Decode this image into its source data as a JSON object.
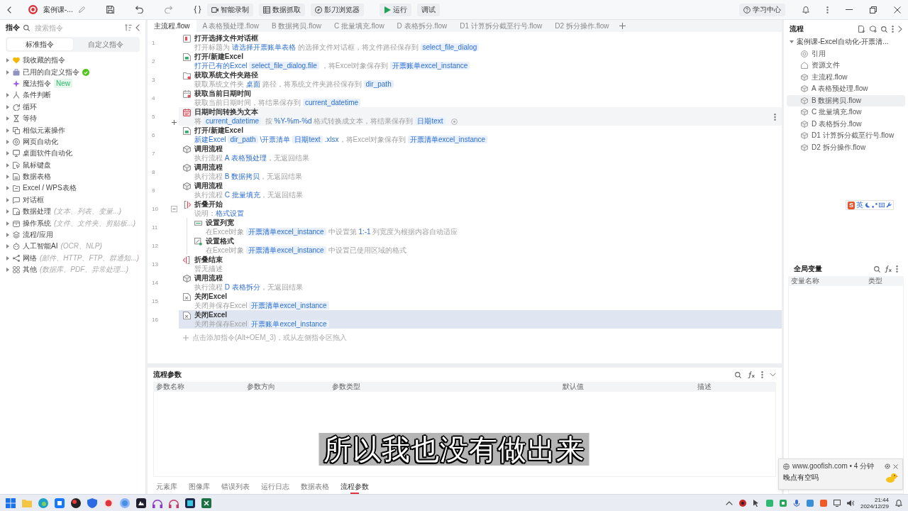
{
  "toolbar": {
    "title": "案例课-...",
    "actions": [
      {
        "kind": "record",
        "label": "智能录制"
      },
      {
        "kind": "capture",
        "label": "数据抓取"
      },
      {
        "kind": "browser",
        "label": "影刀浏览器"
      },
      {
        "kind": "run",
        "label": "运行"
      },
      {
        "kind": "debug",
        "label": "调试"
      }
    ],
    "help": "学习中心"
  },
  "commands": {
    "title": "指令",
    "search": {
      "placeholder": "搜索指令"
    },
    "tabs": [
      {
        "label": "标准指令",
        "selected": true
      },
      {
        "label": "自定义指令",
        "selected": false
      }
    ],
    "items": [
      {
        "kind": "favorites",
        "label": "我收藏的指令",
        "expanded": false
      },
      {
        "kind": "custom",
        "label": "已用的自定义指令",
        "expanded": false
      },
      {
        "kind": "magic",
        "label": "魔法指令",
        "tag": "New"
      },
      {
        "kind": "condition",
        "label": "条件判断",
        "expanded": false
      },
      {
        "kind": "loop",
        "label": "循环",
        "expanded": false
      },
      {
        "kind": "wait",
        "label": "等待",
        "expanded": false
      },
      {
        "kind": "similar",
        "label": "相似元素操作",
        "expanded": false
      },
      {
        "kind": "web",
        "label": "网页自动化",
        "expanded": false
      },
      {
        "kind": "desktop",
        "label": "桌面软件自动化",
        "expanded": false
      },
      {
        "kind": "mouse",
        "label": "鼠标键盘",
        "expanded": false
      },
      {
        "kind": "datatable",
        "label": "数据表格",
        "expanded": false
      },
      {
        "kind": "excel",
        "label": "Excel / WPS表格",
        "expanded": false
      },
      {
        "kind": "dialog",
        "label": "对话框",
        "expanded": false
      },
      {
        "kind": "data",
        "label": "数据处理",
        "hint": "(文本、列表、变量...)",
        "expanded": false
      },
      {
        "kind": "os",
        "label": "操作系统",
        "hint": "(文件、文件夹、剪贴板...)",
        "expanded": false
      },
      {
        "kind": "flow",
        "label": "流程/应用",
        "expanded": false
      },
      {
        "kind": "ai",
        "label": "人工智能AI",
        "hint": "(OCR、NLP)",
        "expanded": false
      },
      {
        "kind": "network",
        "label": "网络",
        "hint": "(邮件、HTTP、FTP、群通知...)",
        "expanded": false
      },
      {
        "kind": "other",
        "label": "其他",
        "hint": "(数据库、PDF、异常处理...)",
        "expanded": false
      }
    ]
  },
  "editor": {
    "tabs": [
      {
        "label": "主流程.flow",
        "selected": true
      },
      {
        "label": "A 表格预处理.flow",
        "selected": false
      },
      {
        "label": "B 数据拷贝.flow",
        "selected": false
      },
      {
        "label": "C 批量填充.flow",
        "selected": false
      },
      {
        "label": "D 表格拆分.flow",
        "selected": false
      },
      {
        "label": "D1 计算拆分截至行号.flow",
        "selected": false
      },
      {
        "label": "D2 拆分操作.flow",
        "selected": false
      }
    ],
    "steps": [
      {
        "number": "1",
        "kind": "file-dialog",
        "title": "打开选择文件对话框",
        "parts": [
          {
            "kind": "text",
            "text": "打开标题为 "
          },
          {
            "kind": "value",
            "text": "请选择开票账单表格"
          },
          {
            "kind": "text",
            "text": " 的选择文件对话框，将文件路径保存到"
          },
          {
            "kind": "var",
            "text": "select_file_dialog"
          }
        ],
        "selected": false,
        "hovered": false
      },
      {
        "number": "2",
        "kind": "open-excel",
        "title": "打开/新建Excel",
        "parts": [
          {
            "kind": "value",
            "text": "打开已有的Excel"
          },
          {
            "kind": "var",
            "text": "select_file_dialog.file"
          },
          {
            "kind": "text",
            "text": "，将Excel对象保存到"
          },
          {
            "kind": "var",
            "text": "开票账单excel_instance"
          }
        ],
        "selected": false,
        "hovered": false
      },
      {
        "number": "3",
        "kind": "folder-path",
        "title": "获取系统文件夹路径",
        "parts": [
          {
            "kind": "text",
            "text": "获取系统文件夹 "
          },
          {
            "kind": "value",
            "text": "桌面"
          },
          {
            "kind": "text",
            "text": " 路径，将系统文件夹路径保存到"
          },
          {
            "kind": "var",
            "text": "dir_path"
          }
        ],
        "selected": false,
        "hovered": false
      },
      {
        "number": "4",
        "kind": "datetime",
        "title": "获取当前日期时间",
        "parts": [
          {
            "kind": "text",
            "text": "获取当前日期时间，将结果保存到"
          },
          {
            "kind": "var",
            "text": "current_datetime"
          }
        ],
        "selected": false,
        "hovered": false
      },
      {
        "number": "5",
        "kind": "datetime-text",
        "title": "日期时间转换为文本",
        "parts": [
          {
            "kind": "text",
            "text": "将"
          },
          {
            "kind": "var",
            "text": "current_datetime"
          },
          {
            "kind": "text",
            "text": " 按 "
          },
          {
            "kind": "value",
            "text": "%Y-%m-%d"
          },
          {
            "kind": "text",
            "text": " 格式转换成文本，将结果保存到"
          },
          {
            "kind": "var",
            "text": "日期text"
          },
          {
            "kind": "icon"
          }
        ],
        "selected": false,
        "hovered": true
      },
      {
        "number": "6",
        "kind": "open-excel",
        "title": "打开/新建Excel",
        "parts": [
          {
            "kind": "value",
            "text": "新建Excel"
          },
          {
            "kind": "var",
            "text": "dir_path"
          },
          {
            "kind": "value",
            "text": "\\开票清单"
          },
          {
            "kind": "var",
            "text": "日期text"
          },
          {
            "kind": "value",
            "text": ".xlsx"
          },
          {
            "kind": "text",
            "text": "，将Excel对象保存到"
          },
          {
            "kind": "var",
            "text": "开票清单excel_instance"
          }
        ],
        "selected": false,
        "hovered": false
      },
      {
        "number": "7",
        "kind": "subflow",
        "title": "调用流程",
        "parts": [
          {
            "kind": "text",
            "text": "执行流程 "
          },
          {
            "kind": "value",
            "text": "A 表格预处理"
          },
          {
            "kind": "text",
            "text": "，无返回结果"
          }
        ],
        "selected": false,
        "hovered": false
      },
      {
        "number": "8",
        "kind": "subflow",
        "title": "调用流程",
        "parts": [
          {
            "kind": "text",
            "text": "执行流程 "
          },
          {
            "kind": "value",
            "text": "B 数据拷贝"
          },
          {
            "kind": "text",
            "text": "，无返回结果"
          }
        ],
        "selected": false,
        "hovered": false
      },
      {
        "number": "9",
        "kind": "subflow",
        "title": "调用流程",
        "parts": [
          {
            "kind": "text",
            "text": "执行流程 "
          },
          {
            "kind": "value",
            "text": "C 批量填充"
          },
          {
            "kind": "text",
            "text": "，无返回结果"
          }
        ],
        "selected": false,
        "hovered": false
      },
      {
        "number": "10",
        "kind": "fold-start",
        "title": "折叠开始",
        "parts": [
          {
            "kind": "text",
            "text": "说明："
          },
          {
            "kind": "value",
            "text": "格式设置"
          }
        ],
        "selected": false,
        "hovered": false,
        "expanded": true,
        "children": [
          {
            "number": "11",
            "kind": "column-width",
            "title": "设置列宽",
            "parts": [
              {
                "kind": "text",
                "text": "在Excel对象"
              },
              {
                "kind": "var",
                "text": "开票清单excel_instance"
              },
              {
                "kind": "text",
                "text": "中设置第 "
              },
              {
                "kind": "value",
                "text": "1:-1"
              },
              {
                "kind": "text",
                "text": " 列宽度为根据内容自动适应"
              }
            ],
            "selected": false,
            "hovered": false
          },
          {
            "number": "12",
            "kind": "cell-format",
            "title": "设置格式",
            "parts": [
              {
                "kind": "text",
                "text": "在Excel对象"
              },
              {
                "kind": "var",
                "text": "开票清单excel_instance"
              },
              {
                "kind": "text",
                "text": "中设置已使用区域的格式"
              }
            ],
            "selected": false,
            "hovered": false
          }
        ]
      },
      {
        "number": "13",
        "kind": "fold-end",
        "title": "折叠结束",
        "parts": [
          {
            "kind": "text",
            "text": "暂无描述"
          }
        ],
        "selected": false,
        "hovered": false
      },
      {
        "number": "14",
        "kind": "subflow",
        "title": "调用流程",
        "parts": [
          {
            "kind": "text",
            "text": "执行流程 "
          },
          {
            "kind": "value",
            "text": "D 表格拆分"
          },
          {
            "kind": "text",
            "text": "，无返回结果"
          }
        ],
        "selected": false,
        "hovered": false
      },
      {
        "number": "15",
        "kind": "close-excel",
        "title": "关闭Excel",
        "parts": [
          {
            "kind": "text",
            "text": "关闭并保存Excel"
          },
          {
            "kind": "var",
            "text": "开票清单excel_instance"
          }
        ],
        "selected": false,
        "hovered": false
      },
      {
        "number": "16",
        "kind": "close-excel",
        "title": "关闭Excel",
        "parts": [
          {
            "kind": "text",
            "text": "关闭并保存Excel"
          },
          {
            "kind": "var",
            "text": "开票账单excel_instance"
          }
        ],
        "selected": true,
        "hovered": false
      }
    ],
    "add_hint": "点击添加指令(Alt+OEM_3)，或从左侧指令区拖入"
  },
  "flow_params": {
    "title": "流程参数",
    "columns": [
      "参数名称",
      "参数方向",
      "参数类型",
      "默认值",
      "描述"
    ]
  },
  "bottom_tabs": [
    {
      "label": "元素库",
      "selected": false
    },
    {
      "label": "图像库",
      "selected": false
    },
    {
      "label": "错误列表",
      "selected": false
    },
    {
      "label": "运行日志",
      "selected": false
    },
    {
      "label": "数据表格",
      "selected": false
    },
    {
      "label": "流程参数",
      "selected": true
    }
  ],
  "flows": {
    "title": "流程",
    "root": {
      "label": "案例课-Excel自动化-开票清...",
      "expanded": true,
      "children": [
        {
          "kind": "reference",
          "label": "引用",
          "selected": false
        },
        {
          "kind": "resource",
          "label": "资源文件",
          "selected": false
        },
        {
          "kind": "flow",
          "label": "主流程.flow",
          "selected": false
        },
        {
          "kind": "flow",
          "label": "A 表格预处理.flow",
          "selected": false
        },
        {
          "kind": "flow",
          "label": "B 数据拷贝.flow",
          "selected": true
        },
        {
          "kind": "flow",
          "label": "C 批量填充.flow",
          "selected": false
        },
        {
          "kind": "flow",
          "label": "D 表格拆分.flow",
          "selected": false
        },
        {
          "kind": "flow",
          "label": "D1 计算拆分截至行号.flow",
          "selected": false
        },
        {
          "kind": "flow",
          "label": "D2 拆分操作.flow",
          "selected": false
        }
      ]
    }
  },
  "global_vars": {
    "title": "全局变量",
    "columns": [
      "变量名称",
      "类型"
    ]
  },
  "ime_toolbar": {
    "logo": "S",
    "mode": "英"
  },
  "notification": {
    "meta": "www.goofish.com • 4 分钟",
    "message": "晚点有空吗"
  },
  "subtitle": "所以我也没有做出来",
  "taskbar": {
    "time": "21:44",
    "date": "2024/12/29"
  }
}
